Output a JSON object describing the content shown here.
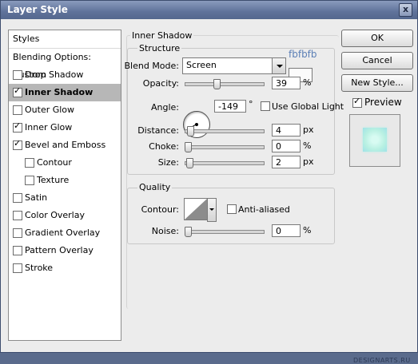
{
  "window": {
    "title": "Layer Style",
    "close_label": "x"
  },
  "style_list": {
    "header": "Styles",
    "items": [
      {
        "label": "Blending Options: Custom",
        "checkbox": false,
        "checked": false,
        "selected": false,
        "indent": 0
      },
      {
        "label": "Drop Shadow",
        "checkbox": true,
        "checked": false,
        "selected": false,
        "indent": 0
      },
      {
        "label": "Inner Shadow",
        "checkbox": true,
        "checked": true,
        "selected": true,
        "indent": 0
      },
      {
        "label": "Outer Glow",
        "checkbox": true,
        "checked": false,
        "selected": false,
        "indent": 0
      },
      {
        "label": "Inner Glow",
        "checkbox": true,
        "checked": true,
        "selected": false,
        "indent": 0
      },
      {
        "label": "Bevel and Emboss",
        "checkbox": true,
        "checked": true,
        "selected": false,
        "indent": 0
      },
      {
        "label": "Contour",
        "checkbox": true,
        "checked": false,
        "selected": false,
        "indent": 1
      },
      {
        "label": "Texture",
        "checkbox": true,
        "checked": false,
        "selected": false,
        "indent": 1
      },
      {
        "label": "Satin",
        "checkbox": true,
        "checked": false,
        "selected": false,
        "indent": 0
      },
      {
        "label": "Color Overlay",
        "checkbox": true,
        "checked": false,
        "selected": false,
        "indent": 0
      },
      {
        "label": "Gradient Overlay",
        "checkbox": true,
        "checked": false,
        "selected": false,
        "indent": 0
      },
      {
        "label": "Pattern Overlay",
        "checkbox": true,
        "checked": false,
        "selected": false,
        "indent": 0
      },
      {
        "label": "Stroke",
        "checkbox": true,
        "checked": false,
        "selected": false,
        "indent": 0
      }
    ]
  },
  "inner_shadow": {
    "title": "Inner Shadow",
    "structure": {
      "title": "Structure",
      "blend_mode_label": "Blend Mode:",
      "blend_mode_value": "Screen",
      "color_hex_label": "fbfbfb",
      "color": "#fbfbfb",
      "opacity_label": "Opacity:",
      "opacity_value": "39",
      "opacity_unit": "%",
      "opacity_fraction": 0.39,
      "angle_label": "Angle:",
      "angle_value": "-149",
      "angle_unit": "°",
      "use_global_light_label": "Use Global Light",
      "use_global_light_checked": false,
      "distance_label": "Distance:",
      "distance_value": "4",
      "distance_unit": "px",
      "choke_label": "Choke:",
      "choke_value": "0",
      "choke_unit": "%",
      "size_label": "Size:",
      "size_value": "2",
      "size_unit": "px"
    },
    "quality": {
      "title": "Quality",
      "contour_label": "Contour:",
      "anti_aliased_label": "Anti-aliased",
      "anti_aliased_checked": false,
      "noise_label": "Noise:",
      "noise_value": "0",
      "noise_unit": "%"
    }
  },
  "buttons": {
    "ok": "OK",
    "cancel": "Cancel",
    "new_style": "New Style...",
    "preview_label": "Preview",
    "preview_checked": true
  },
  "watermark": "DESIGNARTS.RU",
  "colors": {
    "title_bar": "#5f729a",
    "selection": "#b7b7b7",
    "hex_label": "#5c7fb6"
  }
}
